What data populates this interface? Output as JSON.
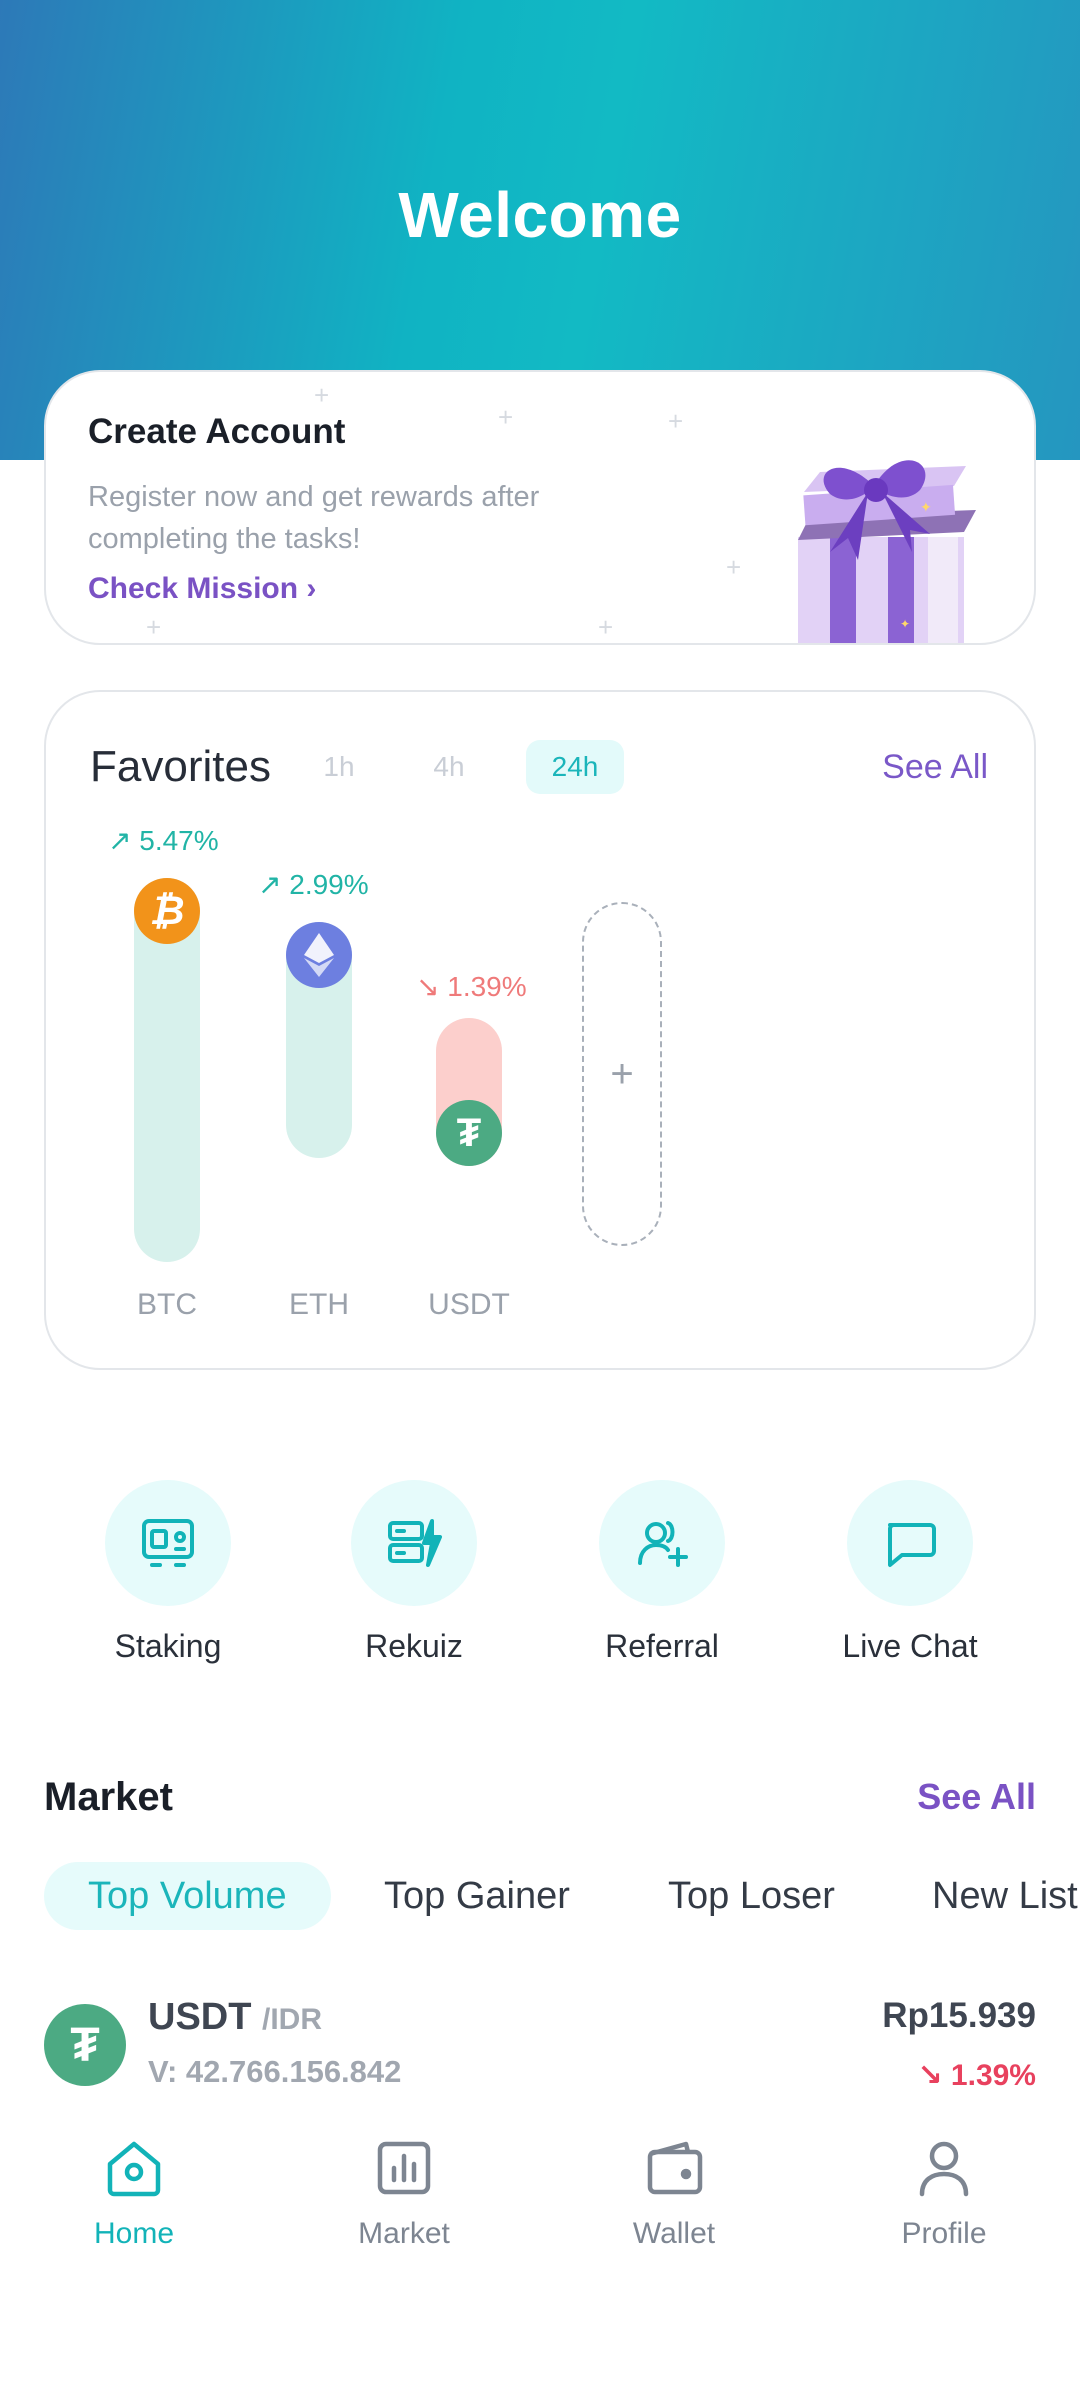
{
  "header": {
    "title": "Welcome"
  },
  "create_account": {
    "title": "Create Account",
    "description": "Register now and get rewards after completing the tasks!",
    "link": "Check Mission ›"
  },
  "favorites": {
    "title": "Favorites",
    "timeframes": [
      "1h",
      "4h",
      "24h"
    ],
    "active_timeframe": "24h",
    "see_all": "See All",
    "coins": [
      {
        "symbol": "BTC",
        "change": "5.47%",
        "direction": "up",
        "level": 1.0
      },
      {
        "symbol": "ETH",
        "change": "2.99%",
        "direction": "up",
        "level": 0.62
      },
      {
        "symbol": "USDT",
        "change": "1.39%",
        "direction": "down",
        "level": 0.3
      }
    ],
    "add_slot_icon": "+"
  },
  "quick_actions": [
    {
      "label": "Staking",
      "icon": "staking-icon"
    },
    {
      "label": "Rekuiz",
      "icon": "quiz-icon"
    },
    {
      "label": "Referral",
      "icon": "referral-icon"
    },
    {
      "label": "Live Chat",
      "icon": "chat-icon"
    }
  ],
  "market": {
    "title": "Market",
    "see_all": "See All",
    "tabs": [
      "Top Volume",
      "Top Gainer",
      "Top Loser",
      "New List"
    ],
    "active_tab": "Top Volume",
    "rows": [
      {
        "base": "USDT",
        "quote": "/IDR",
        "volume": "V: 42.766.156.842",
        "price": "Rp15.939",
        "change": "1.39%",
        "direction": "down"
      }
    ]
  },
  "nav": [
    {
      "label": "Home",
      "icon": "home-icon",
      "active": true
    },
    {
      "label": "Market",
      "icon": "market-icon",
      "active": false
    },
    {
      "label": "Wallet",
      "icon": "wallet-icon",
      "active": false
    },
    {
      "label": "Profile",
      "icon": "profile-icon",
      "active": false
    }
  ],
  "colors": {
    "accent": "#12b3b8",
    "purple": "#7a52c4",
    "up": "#21b4a6",
    "down": "#e8415e",
    "btc": "#f2931a",
    "eth": "#6d7fe0",
    "usdt": "#4caa83"
  }
}
